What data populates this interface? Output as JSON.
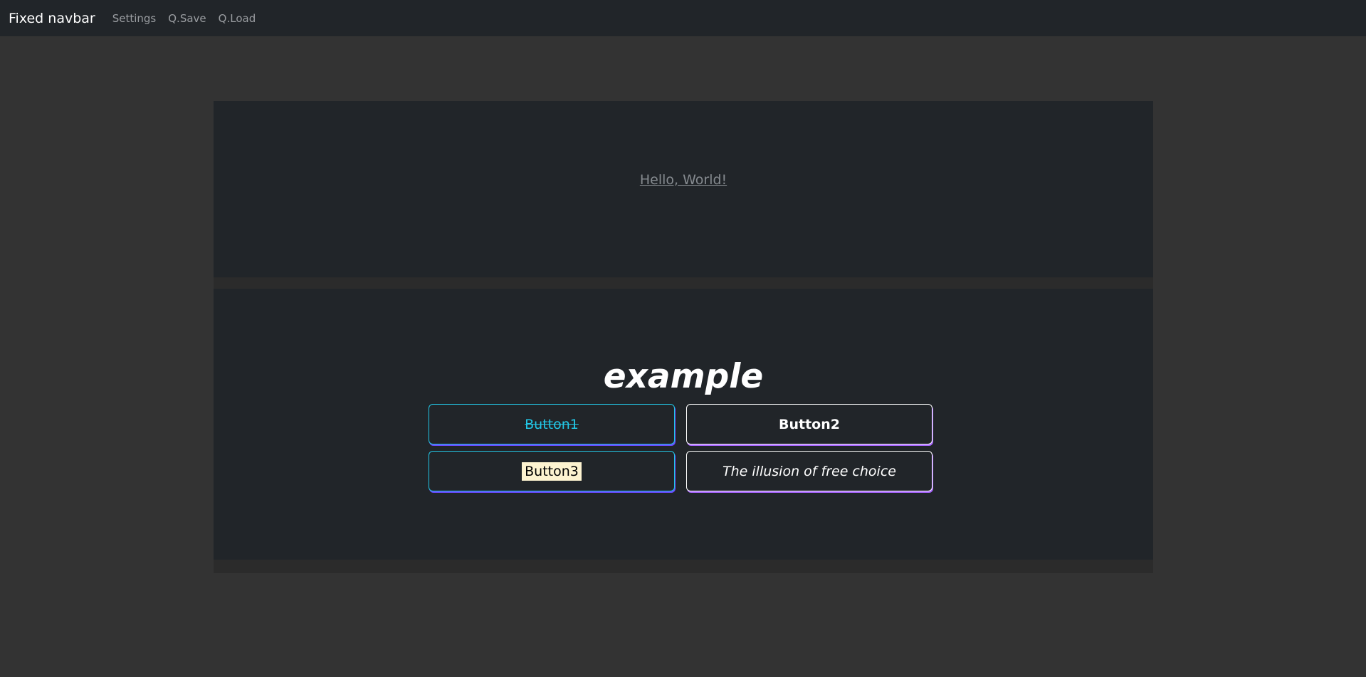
{
  "navbar": {
    "brand": "Fixed navbar",
    "links": [
      "Settings",
      "Q.Save",
      "Q.Load"
    ]
  },
  "top_panel": {
    "link_text": "Hello, World!"
  },
  "main_panel": {
    "title": "example",
    "buttons": [
      {
        "label": "Button1"
      },
      {
        "label": "Button2"
      },
      {
        "label": "Button3"
      },
      {
        "label": "The illusion of free choice"
      }
    ]
  },
  "colors": {
    "page_background": "#333333",
    "panel_background": "#212529",
    "accent_cyan": "#22c7e6",
    "accent_purple": "#a865ff",
    "highlight": "#fdf3d0"
  }
}
